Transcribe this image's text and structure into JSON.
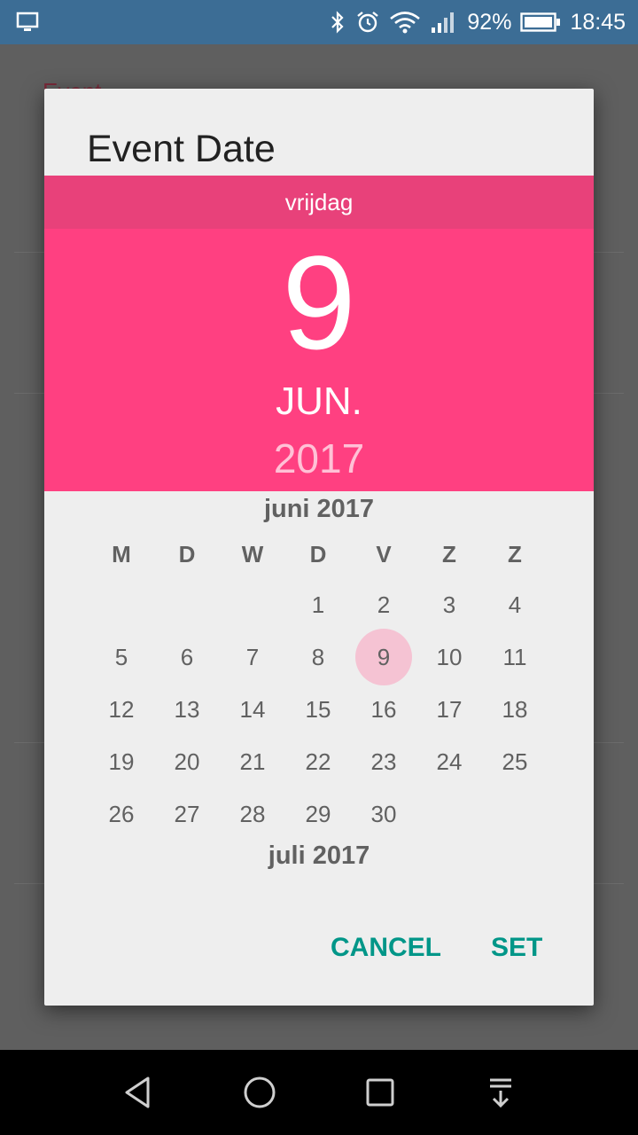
{
  "status_bar": {
    "left_icon": "cast-screen-icon",
    "icons": [
      "bluetooth-icon",
      "alarm-icon",
      "wifi-icon",
      "signal-icon"
    ],
    "battery": "92%",
    "time": "18:45"
  },
  "background": {
    "title": "Event"
  },
  "dialog": {
    "title": "Event Date",
    "weekday": "vrijdag",
    "day": "9",
    "month_abbr": "JUN.",
    "year": "2017",
    "month_label": "juni 2017",
    "next_month_label": "juli 2017",
    "weekday_headers": [
      "M",
      "D",
      "W",
      "D",
      "V",
      "Z",
      "Z"
    ],
    "days": [
      "1",
      "2",
      "3",
      "4",
      "5",
      "6",
      "7",
      "8",
      "9",
      "10",
      "11",
      "12",
      "13",
      "14",
      "15",
      "16",
      "17",
      "18",
      "19",
      "20",
      "21",
      "22",
      "23",
      "24",
      "25",
      "26",
      "27",
      "28",
      "29",
      "30"
    ],
    "selected_day": "9",
    "cancel_label": "CANCEL",
    "set_label": "SET"
  },
  "colors": {
    "accent": "#ff4081",
    "accent_dark": "#e8417a",
    "button_text": "#009688",
    "status_bar": "#3c6d95"
  },
  "navigation": {
    "back": "back-icon",
    "home": "home-icon",
    "recents": "recents-icon",
    "notifications": "notification-pull-icon"
  }
}
